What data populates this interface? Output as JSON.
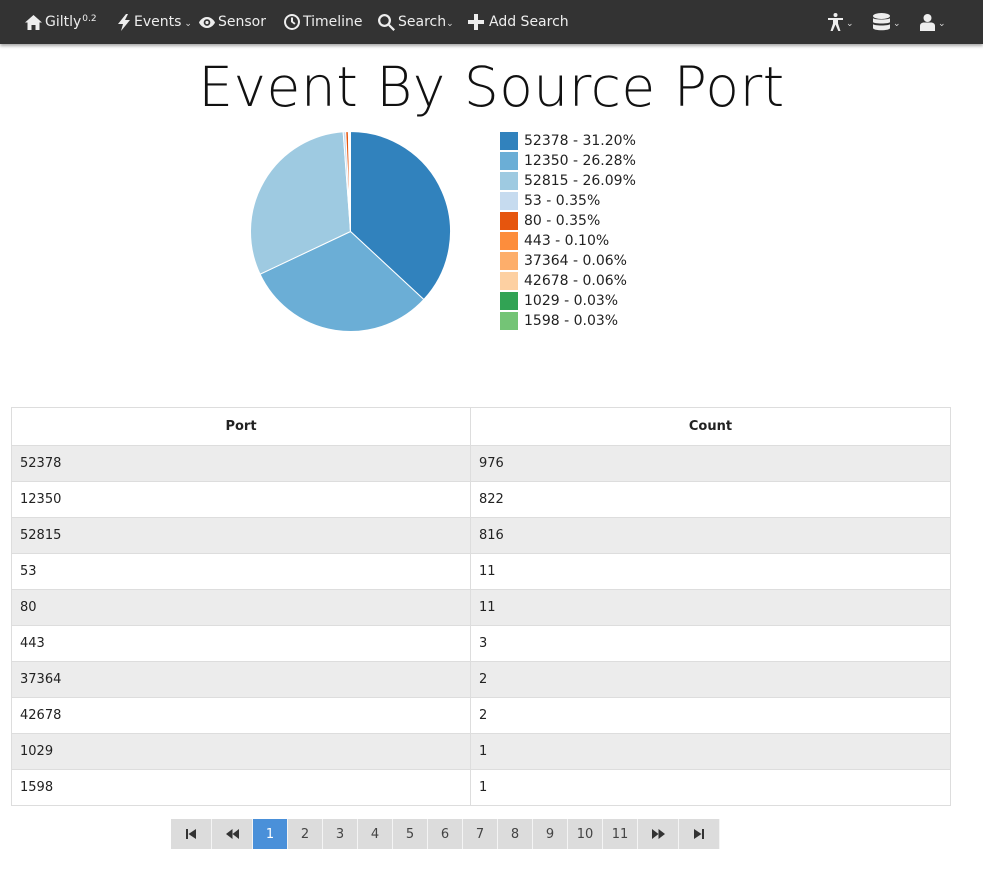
{
  "nav": {
    "brand": "Giltly",
    "brand_version": "0.2",
    "events": "Events",
    "sensor": "Sensor",
    "timeline": "Timeline",
    "search": "Search",
    "add_search": "Add Search",
    "caret": "⌄"
  },
  "page": {
    "title": "Event By Source Port"
  },
  "chart_data": {
    "type": "pie",
    "title": "Event By Source Port",
    "slices": [
      {
        "label": "52378 - 31.20%",
        "port": "52378",
        "count": 976,
        "percent": 31.2,
        "color": "#3182bd"
      },
      {
        "label": "12350 - 26.28%",
        "port": "12350",
        "count": 822,
        "percent": 26.28,
        "color": "#6baed6"
      },
      {
        "label": "52815 - 26.09%",
        "port": "52815",
        "count": 816,
        "percent": 26.09,
        "color": "#9ecae1"
      },
      {
        "label": "53 - 0.35%",
        "port": "53",
        "count": 11,
        "percent": 0.35,
        "color": "#c6dbef"
      },
      {
        "label": "80 - 0.35%",
        "port": "80",
        "count": 11,
        "percent": 0.35,
        "color": "#e6550d"
      },
      {
        "label": "443 - 0.10%",
        "port": "443",
        "count": 3,
        "percent": 0.1,
        "color": "#fd8d3c"
      },
      {
        "label": "37364 - 0.06%",
        "port": "37364",
        "count": 2,
        "percent": 0.06,
        "color": "#fdae6b"
      },
      {
        "label": "42678 - 0.06%",
        "port": "42678",
        "count": 2,
        "percent": 0.06,
        "color": "#fdd0a2"
      },
      {
        "label": "1029 - 0.03%",
        "port": "1029",
        "count": 1,
        "percent": 0.03,
        "color": "#31a354"
      },
      {
        "label": "1598 - 0.03%",
        "port": "1598",
        "count": 1,
        "percent": 0.03,
        "color": "#74c476"
      }
    ],
    "legend_position": "right"
  },
  "table": {
    "headers": [
      "Port",
      "Count"
    ],
    "rows": [
      [
        "52378",
        "976"
      ],
      [
        "12350",
        "822"
      ],
      [
        "52815",
        "816"
      ],
      [
        "53",
        "11"
      ],
      [
        "80",
        "11"
      ],
      [
        "443",
        "3"
      ],
      [
        "37364",
        "2"
      ],
      [
        "42678",
        "2"
      ],
      [
        "1029",
        "1"
      ],
      [
        "1598",
        "1"
      ]
    ]
  },
  "pagination": {
    "pages": [
      "1",
      "2",
      "3",
      "4",
      "5",
      "6",
      "7",
      "8",
      "9",
      "10",
      "11"
    ],
    "current": "1"
  },
  "icons": {
    "home": "home-icon",
    "events": "bolt-icon",
    "sensor": "eye-icon",
    "timeline": "clock-icon",
    "search": "magnifier-icon",
    "add": "plus-icon",
    "accessibility": "accessibility-icon",
    "database": "database-icon",
    "user": "user-icon"
  }
}
